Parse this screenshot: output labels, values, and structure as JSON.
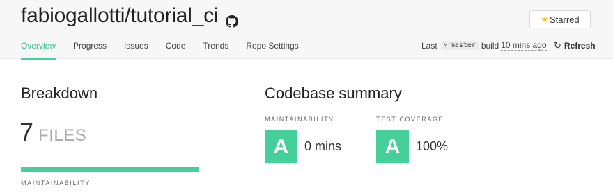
{
  "header": {
    "repo_title": "fabiogallotti/tutorial_ci",
    "starred_label": "Starred",
    "tabs": [
      {
        "label": "Overview",
        "active": true
      },
      {
        "label": "Progress",
        "active": false
      },
      {
        "label": "Issues",
        "active": false
      },
      {
        "label": "Code",
        "active": false
      },
      {
        "label": "Trends",
        "active": false
      },
      {
        "label": "Repo Settings",
        "active": false
      }
    ],
    "build": {
      "prefix": "Last",
      "branch": "master",
      "build_word": "build",
      "ago": "10 mins ago"
    },
    "refresh_label": "Refresh"
  },
  "breakdown": {
    "title": "Breakdown",
    "files_count": "7",
    "files_label": "FILES",
    "maintainability_label": "MAINTAINABILITY"
  },
  "summary": {
    "title": "Codebase summary",
    "maintainability": {
      "label": "MAINTAINABILITY",
      "grade": "A",
      "value": "0 mins"
    },
    "test_coverage": {
      "label": "TEST COVERAGE",
      "grade": "A",
      "value": "100%"
    }
  },
  "colors": {
    "accent": "#45d09b",
    "star": "#f5c518"
  }
}
